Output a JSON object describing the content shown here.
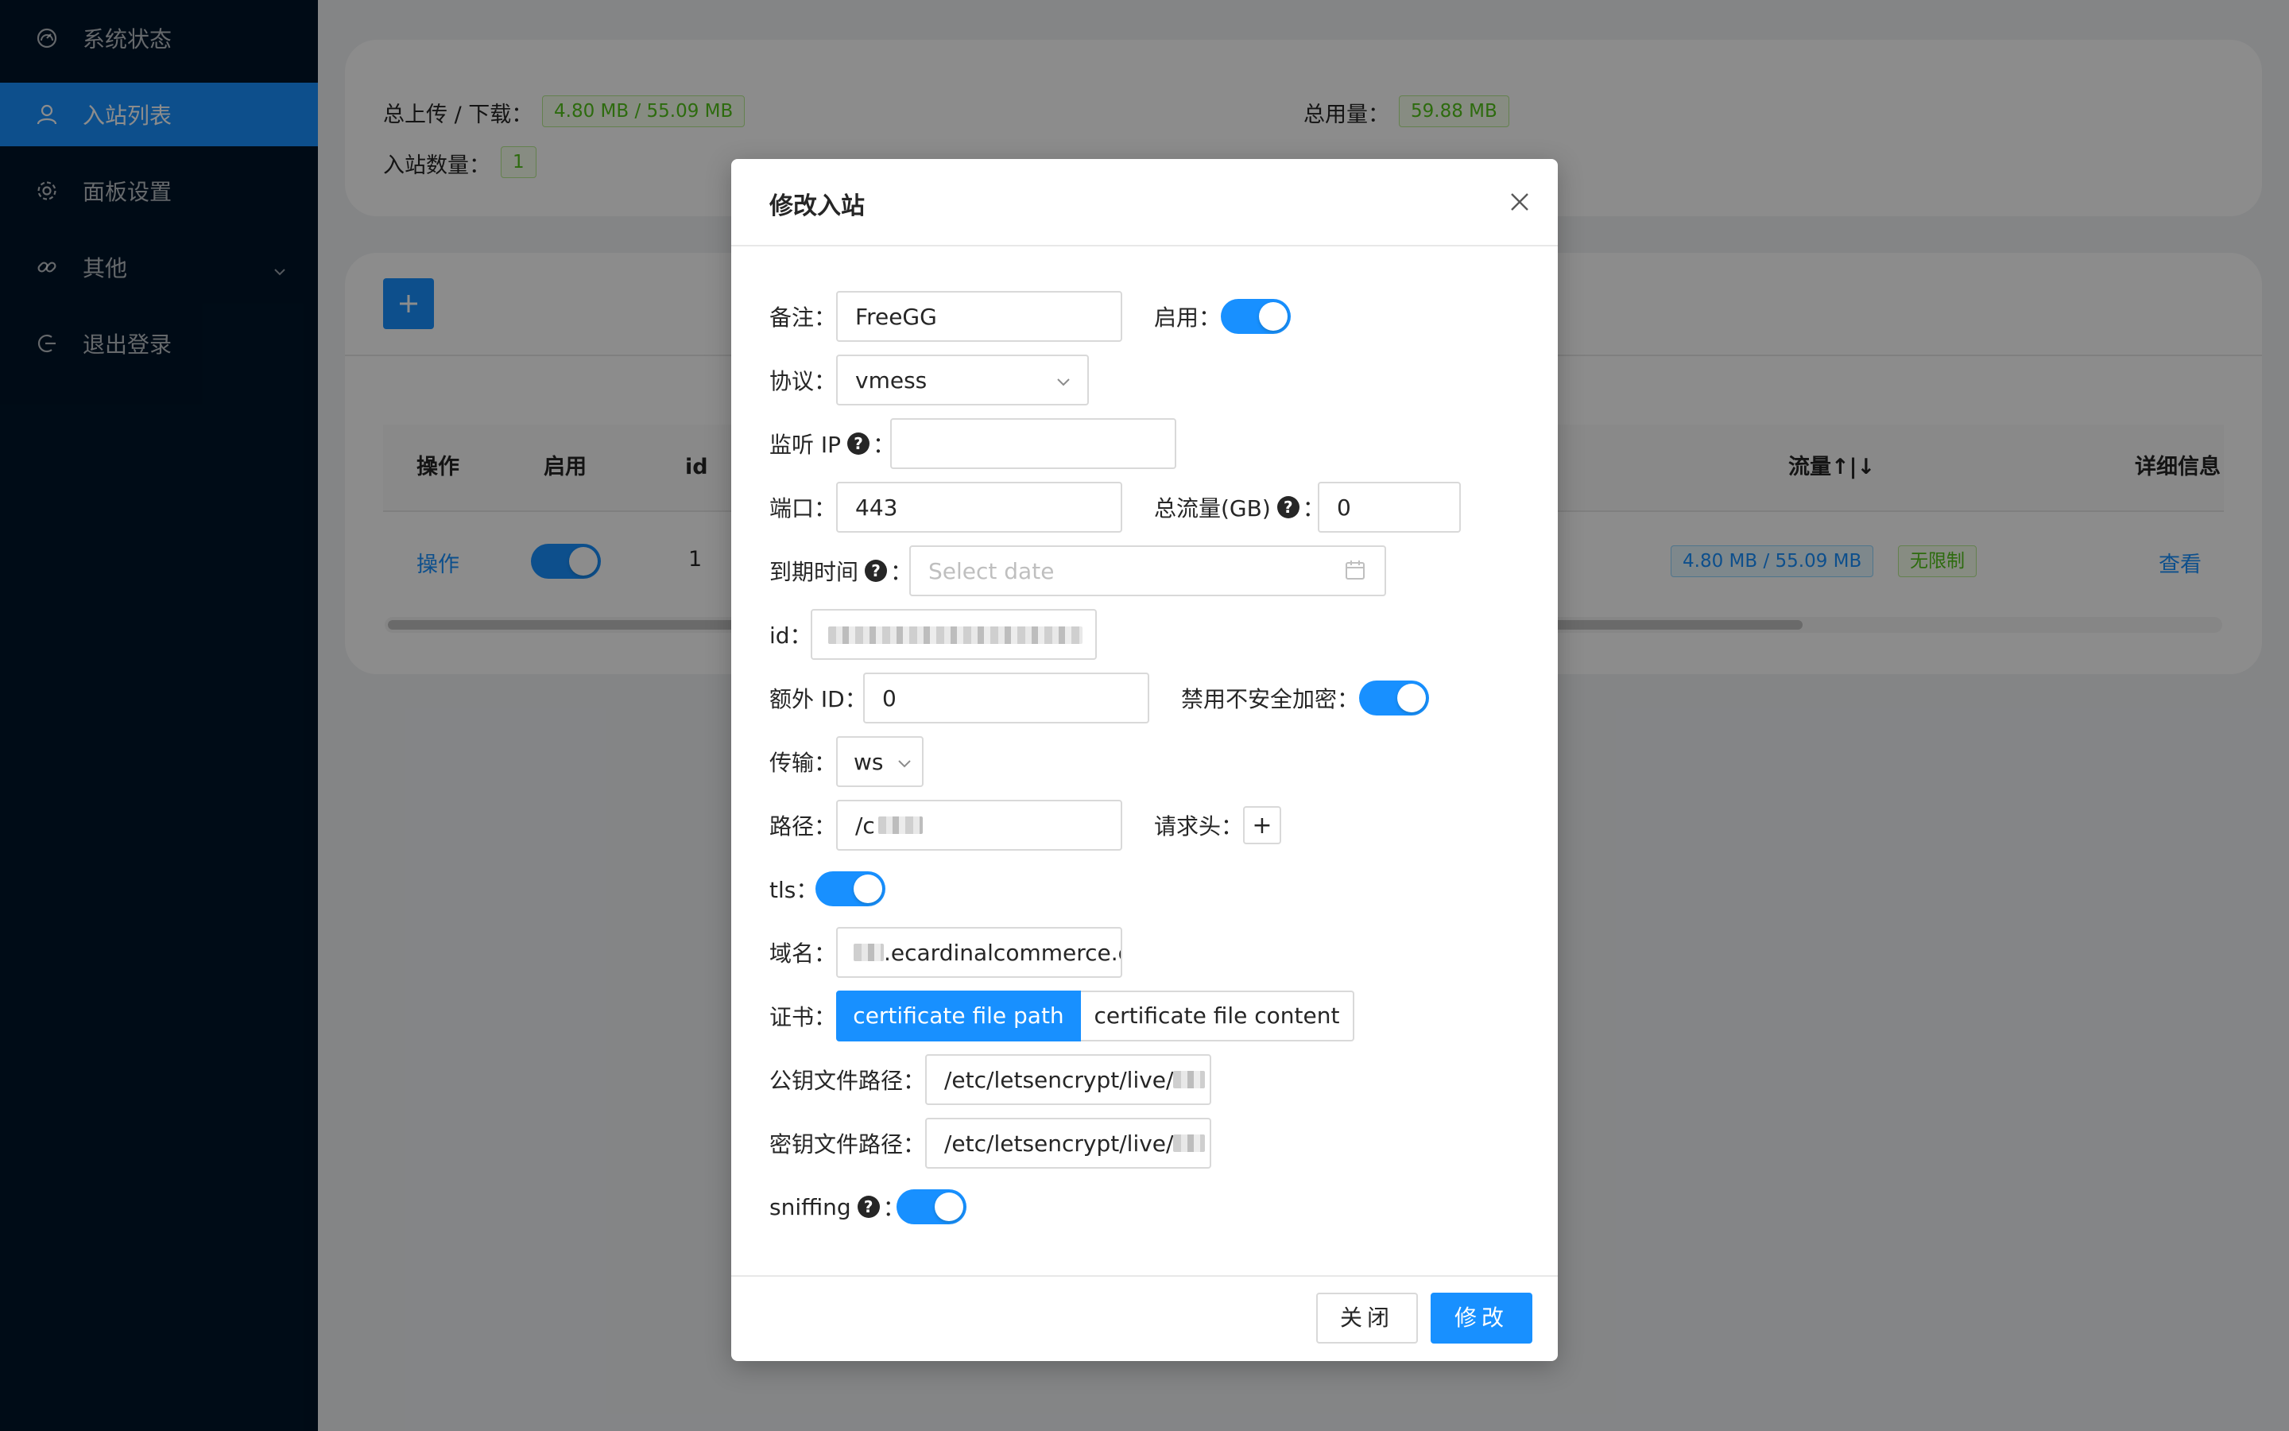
{
  "sidebar": {
    "items": [
      {
        "label": "系统状态",
        "icon": "dashboard-icon"
      },
      {
        "label": "入站列表",
        "icon": "user-icon",
        "active": true
      },
      {
        "label": "面板设置",
        "icon": "gear-icon"
      },
      {
        "label": "其他",
        "icon": "link-icon",
        "has_submenu": true
      },
      {
        "label": "退出登录",
        "icon": "logout-icon"
      }
    ]
  },
  "stats": {
    "upload_download_label": "总上传 / 下载：",
    "upload_download_value": "4.80 MB / 55.09 MB",
    "total_usage_label": "总用量：",
    "total_usage_value": "59.88 MB",
    "inbound_count_label": "入站数量：",
    "inbound_count_value": "1"
  },
  "table": {
    "headers": {
      "action": "操作",
      "enable": "启用",
      "id": "id",
      "traffic": "流量↑|↓",
      "details": "详细信息"
    },
    "row": {
      "action": "操作",
      "id": "1",
      "traffic": "4.80 MB / 55.09 MB",
      "limit": "无限制",
      "details": "查看"
    }
  },
  "modal": {
    "title": "修改入站",
    "fields": {
      "remark_label": "备注：",
      "remark_value": "FreeGG",
      "enable_label": "启用：",
      "protocol_label": "协议：",
      "protocol_value": "vmess",
      "listen_ip_label": "监听 IP",
      "listen_ip_value": "",
      "port_label": "端口：",
      "port_value": "443",
      "total_traffic_label": "总流量(GB)",
      "total_traffic_value": "0",
      "expiry_label": "到期时间",
      "expiry_placeholder": "Select date",
      "id_label": "id：",
      "alter_id_label": "额外 ID：",
      "alter_id_value": "0",
      "disable_insecure_label": "禁用不安全加密：",
      "transport_label": "传输：",
      "transport_value": "ws",
      "path_label": "路径：",
      "path_value": "/c",
      "headers_label": "请求头：",
      "headers_add": "+",
      "tls_label": "tls：",
      "domain_label": "域名：",
      "domain_value": ".ecardinalcommerce.c",
      "cert_label": "证书：",
      "cert_option_path": "certificate file path",
      "cert_option_content": "certificate file content",
      "public_key_label": "公钥文件路径：",
      "public_key_value": "/etc/letsencrypt/live/",
      "private_key_label": "密钥文件路径：",
      "private_key_value": "/etc/letsencrypt/live/",
      "sniffing_label": "sniffing",
      "colon": "："
    },
    "footer": {
      "close_label": "关闭",
      "submit_label": "修改"
    }
  },
  "colors": {
    "primary": "#1890ff",
    "sidebar_bg": "#001529",
    "tag_green": "#52c41a"
  }
}
